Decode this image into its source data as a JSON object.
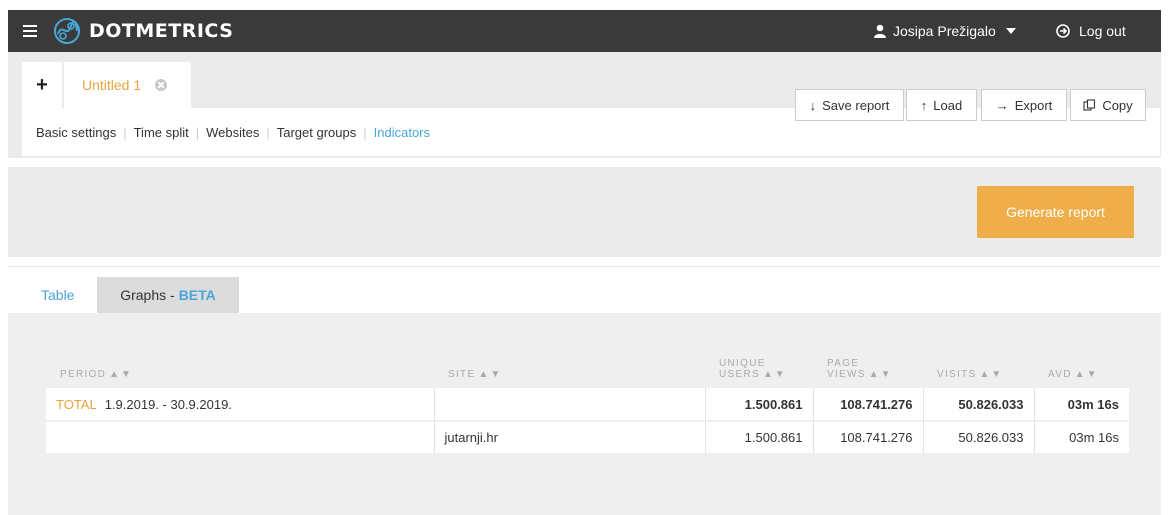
{
  "header": {
    "brand": "DOTMETRICS",
    "user_name": "Josipa Prežigalo",
    "logout_label": "Log out"
  },
  "tabs": {
    "add_label": "+",
    "active_tab_label": "Untitled 1"
  },
  "subnav": {
    "links": [
      "Basic settings",
      "Time split",
      "Websites",
      "Target groups",
      "Indicators"
    ],
    "active": "Indicators"
  },
  "toolbar": {
    "save_label": "Save report",
    "load_label": "Load",
    "export_label": "Export",
    "copy_label": "Copy"
  },
  "generate_label": "Generate report",
  "result_tabs": {
    "table_label": "Table",
    "graphs_label": "Graphs - ",
    "graphs_badge": "BETA"
  },
  "table": {
    "sort_arrows": "▲▼",
    "columns": [
      {
        "line1": "PERIOD",
        "line2": ""
      },
      {
        "line1": "SITE",
        "line2": ""
      },
      {
        "line1": "UNIQUE",
        "line2": "USERS"
      },
      {
        "line1": "PAGE",
        "line2": "VIEWS"
      },
      {
        "line1": "VISITS",
        "line2": ""
      },
      {
        "line1": "AVD",
        "line2": ""
      }
    ],
    "total_row": {
      "label": "TOTAL",
      "period": "1.9.2019. - 30.9.2019.",
      "site": "",
      "unique_users": "1.500.861",
      "page_views": "108.741.276",
      "visits": "50.826.033",
      "avd": "03m 16s"
    },
    "rows": [
      {
        "period": "",
        "site": "jutarnji.hr",
        "unique_users": "1.500.861",
        "page_views": "108.741.276",
        "visits": "50.826.033",
        "avd": "03m 16s"
      }
    ]
  },
  "colors": {
    "topbar": "#3a3a3a",
    "accent_orange": "#f0ae4b",
    "accent_blue": "#4aa6d6"
  }
}
